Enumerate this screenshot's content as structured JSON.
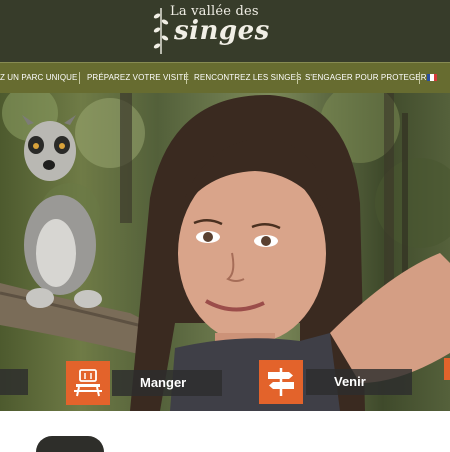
{
  "header": {
    "logo_line1": "La vallée des",
    "logo_line2": "singes",
    "bg_color": "#373c2a"
  },
  "nav": {
    "items": [
      {
        "label": "Z UN PARC UNIQUE"
      },
      {
        "label": "PRÉPAREZ VOTRE VISITE"
      },
      {
        "label": "RENCONTREZ LES SINGES"
      },
      {
        "label": "S'ENGAGER POUR PROTEGER"
      }
    ],
    "language_icon": "france-flag-icon",
    "bg_color": "#676c30"
  },
  "hero": {
    "subjects": [
      "ring-tailed lemur on branch",
      "smiling girl"
    ]
  },
  "cta": [
    {
      "label": "Manger",
      "icon": "picnic-table-icon",
      "accent": "#e3632b"
    },
    {
      "label": "Venir",
      "icon": "signpost-icon",
      "accent": "#e3632b"
    }
  ]
}
